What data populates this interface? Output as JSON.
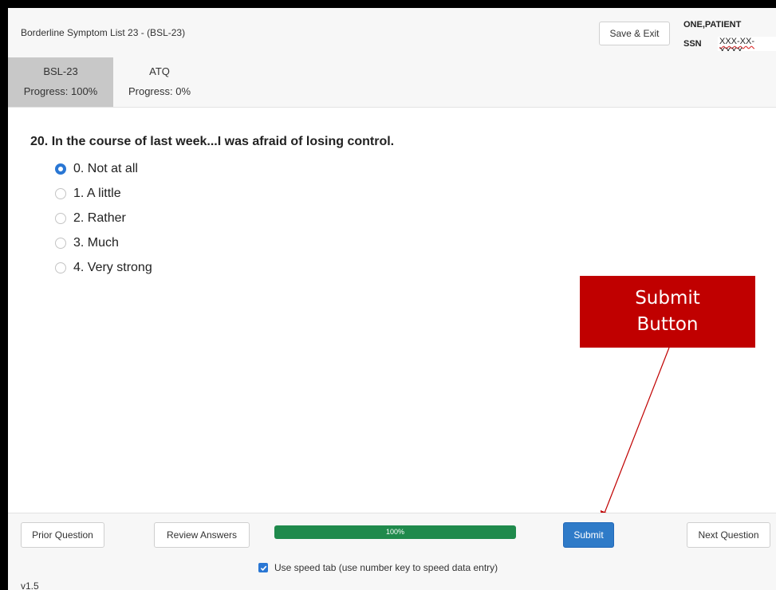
{
  "header": {
    "title": "Borderline Symptom List 23 - (BSL-23)",
    "save_exit_label": "Save & Exit",
    "patient_name": "ONE,PATIENT",
    "ssn_label": "SSN",
    "ssn_value": "XXX-XX-XXXX"
  },
  "tabs": [
    {
      "name": "BSL-23",
      "progress": "Progress: 100%"
    },
    {
      "name": "ATQ",
      "progress": "Progress: 0%"
    }
  ],
  "question": {
    "text": "20. In the course of last week...I was afraid of losing control.",
    "options": [
      {
        "label": "0. Not at all",
        "selected": true
      },
      {
        "label": "1. A little",
        "selected": false
      },
      {
        "label": "2. Rather",
        "selected": false
      },
      {
        "label": "3. Much",
        "selected": false
      },
      {
        "label": "4. Very strong",
        "selected": false
      }
    ]
  },
  "annotation": {
    "line1": "Submit",
    "line2": "Button",
    "color": "#c00000"
  },
  "footer": {
    "prior_label": "Prior Question",
    "review_label": "Review Answers",
    "progress_text": "100%",
    "progress_fraction": 1.0,
    "submit_label": "Submit",
    "next_label": "Next Question",
    "speed_tab_checked": true,
    "speed_tab_label": "Use speed tab (use number key to speed data entry)",
    "version": "v1.5"
  },
  "colors": {
    "accent": "#2a77d4",
    "submit": "#2f7bc8",
    "progress": "#1f8a4c"
  }
}
